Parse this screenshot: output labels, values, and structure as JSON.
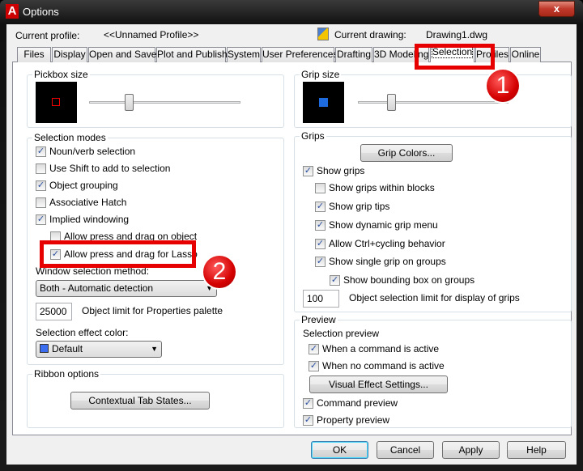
{
  "window": {
    "title": "Options",
    "close_label": "x"
  },
  "header": {
    "current_profile_label": "Current profile:",
    "current_profile_value": "<<Unnamed Profile>>",
    "current_drawing_label": "Current drawing:",
    "current_drawing_value": "Drawing1.dwg"
  },
  "tabs": [
    "Files",
    "Display",
    "Open and Save",
    "Plot and Publish",
    "System",
    "User Preferences",
    "Drafting",
    "3D Modeling",
    "Selection",
    "Profiles",
    "Online"
  ],
  "active_tab": "Selection",
  "pickbox": {
    "label": "Pickbox size",
    "slider_level": 0.26
  },
  "grip_size": {
    "label": "Grip size",
    "slider_level": 0.22
  },
  "selection_modes": {
    "label": "Selection modes",
    "items": [
      {
        "label": "Noun/verb selection",
        "checked": true
      },
      {
        "label": "Use Shift to add to selection",
        "checked": false
      },
      {
        "label": "Object grouping",
        "checked": true
      },
      {
        "label": "Associative Hatch",
        "checked": false
      },
      {
        "label": "Implied windowing",
        "checked": true
      },
      {
        "label": "Allow press and drag on object",
        "checked": false
      },
      {
        "label": "Allow press and drag for Lasso",
        "checked": true
      }
    ],
    "window_method_label": "Window selection method:",
    "window_method_value": "Both - Automatic detection",
    "object_limit_value": "25000",
    "object_limit_label": "Object limit for Properties palette",
    "effect_color_label": "Selection effect color:",
    "effect_color_value": "Default",
    "effect_color_swatch": "#3a6df0"
  },
  "ribbon": {
    "label": "Ribbon options",
    "button": "Contextual Tab States..."
  },
  "grips": {
    "label": "Grips",
    "button": "Grip Colors...",
    "items": [
      {
        "label": "Show grips",
        "checked": true
      },
      {
        "label": "Show grips within blocks",
        "checked": false
      },
      {
        "label": "Show grip tips",
        "checked": true
      },
      {
        "label": "Show dynamic grip menu",
        "checked": true
      },
      {
        "label": "Allow Ctrl+cycling behavior",
        "checked": true
      },
      {
        "label": "Show single grip on groups",
        "checked": true
      },
      {
        "label": "Show bounding box on groups",
        "checked": true
      }
    ],
    "limit_value": "100",
    "limit_label": "Object selection limit for display of grips"
  },
  "preview": {
    "label": "Preview",
    "sub_label": "Selection preview",
    "items": [
      {
        "label": "When a command is active",
        "checked": true
      },
      {
        "label": "When no command is active",
        "checked": true
      },
      {
        "label": "Command preview",
        "checked": true
      },
      {
        "label": "Property preview",
        "checked": true
      }
    ],
    "button": "Visual Effect Settings..."
  },
  "footer": {
    "ok": "OK",
    "cancel": "Cancel",
    "apply": "Apply",
    "help": "Help"
  },
  "annotations": {
    "badge1": "1",
    "badge2": "2",
    "highlight_color": "#e60000"
  }
}
